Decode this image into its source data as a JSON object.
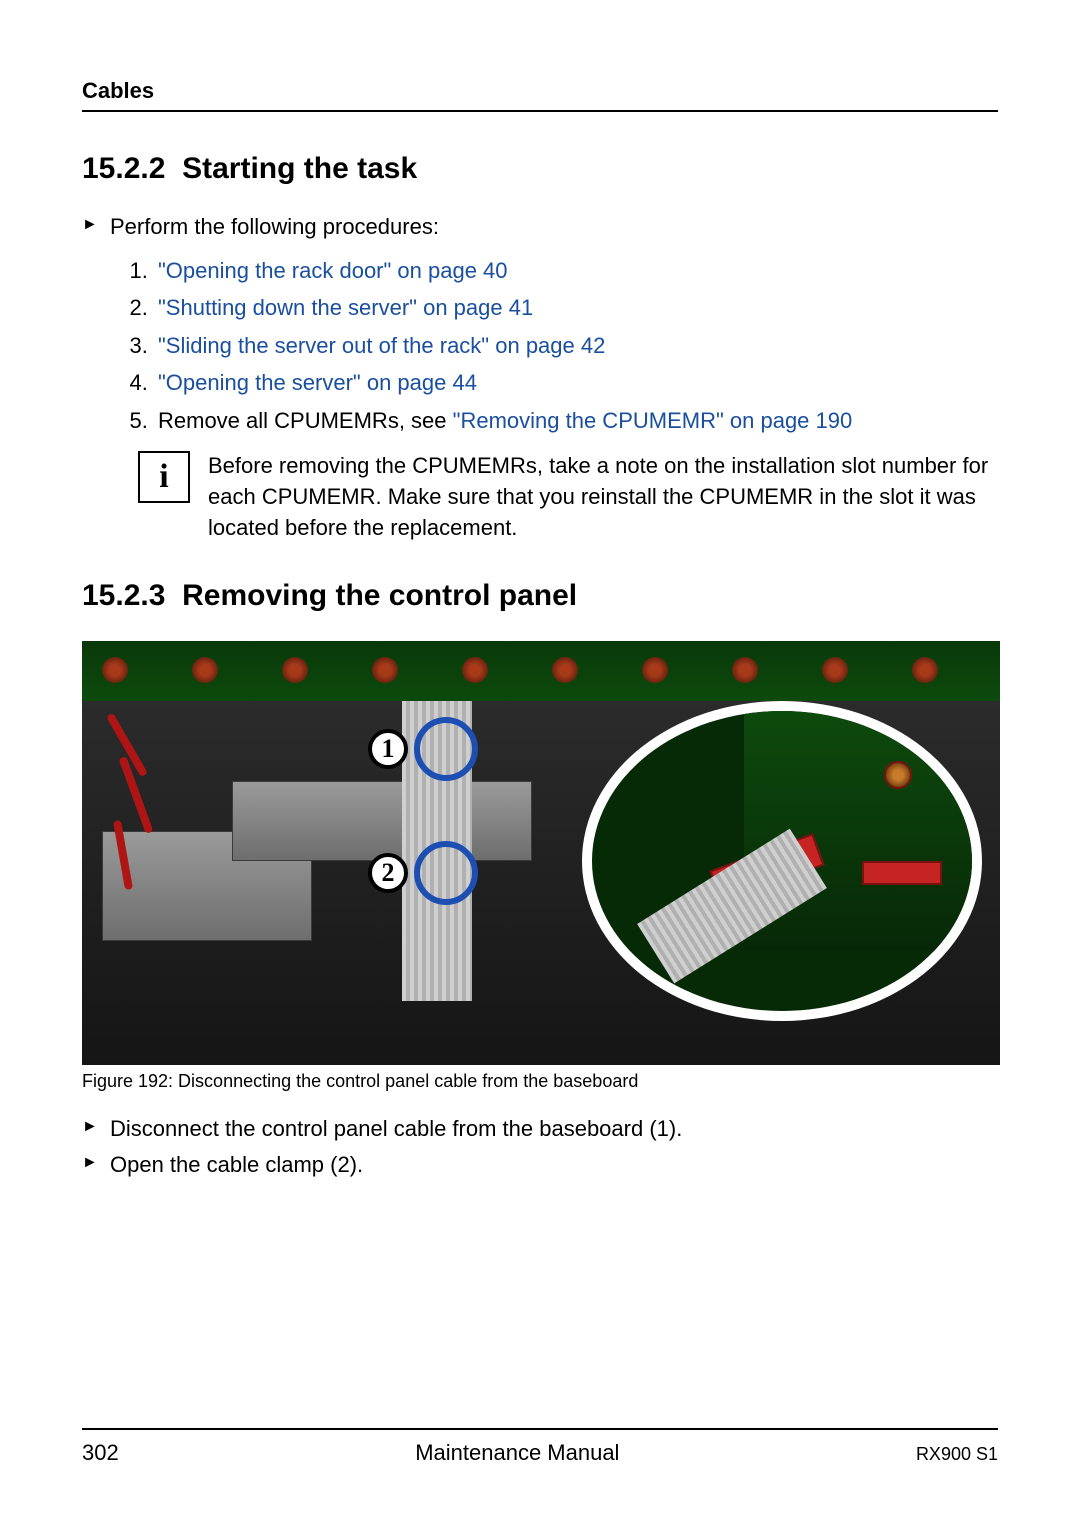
{
  "header": {
    "chapter": "Cables"
  },
  "section_15_2_2": {
    "number": "15.2.2",
    "title": "Starting the task",
    "intro": "Perform the following procedures:",
    "procedures": [
      {
        "n": "1.",
        "link": "\"Opening the rack door\" on page 40",
        "plain": ""
      },
      {
        "n": "2.",
        "link": "\"Shutting down the server\" on page 41",
        "plain": ""
      },
      {
        "n": "3.",
        "link": "\"Sliding the server out of the rack\" on page 42",
        "plain": ""
      },
      {
        "n": "4.",
        "link": "\"Opening the server\" on page 44",
        "plain": ""
      },
      {
        "n": "5.",
        "plain_before": "Remove all CPUMEMRs, see ",
        "link": "\"Removing the CPUMEMR\" on page 190"
      }
    ],
    "info": "Before removing the CPUMEMRs, take a note on the installation slot number for each CPUMEMR. Make sure that you reinstall the CPUMEMR in the slot it was located before the replacement."
  },
  "section_15_2_3": {
    "number": "15.2.3",
    "title": "Removing the control panel",
    "callouts": {
      "one": "1",
      "two": "2"
    },
    "caption": "Figure 192: Disconnecting the control panel cable from the baseboard",
    "steps": [
      "Disconnect the control panel cable from the baseboard (1).",
      "Open the cable clamp (2)."
    ]
  },
  "footer": {
    "page": "302",
    "doc": "Maintenance Manual",
    "model": "RX900 S1"
  },
  "colors": {
    "link": "#1a4fa0"
  }
}
